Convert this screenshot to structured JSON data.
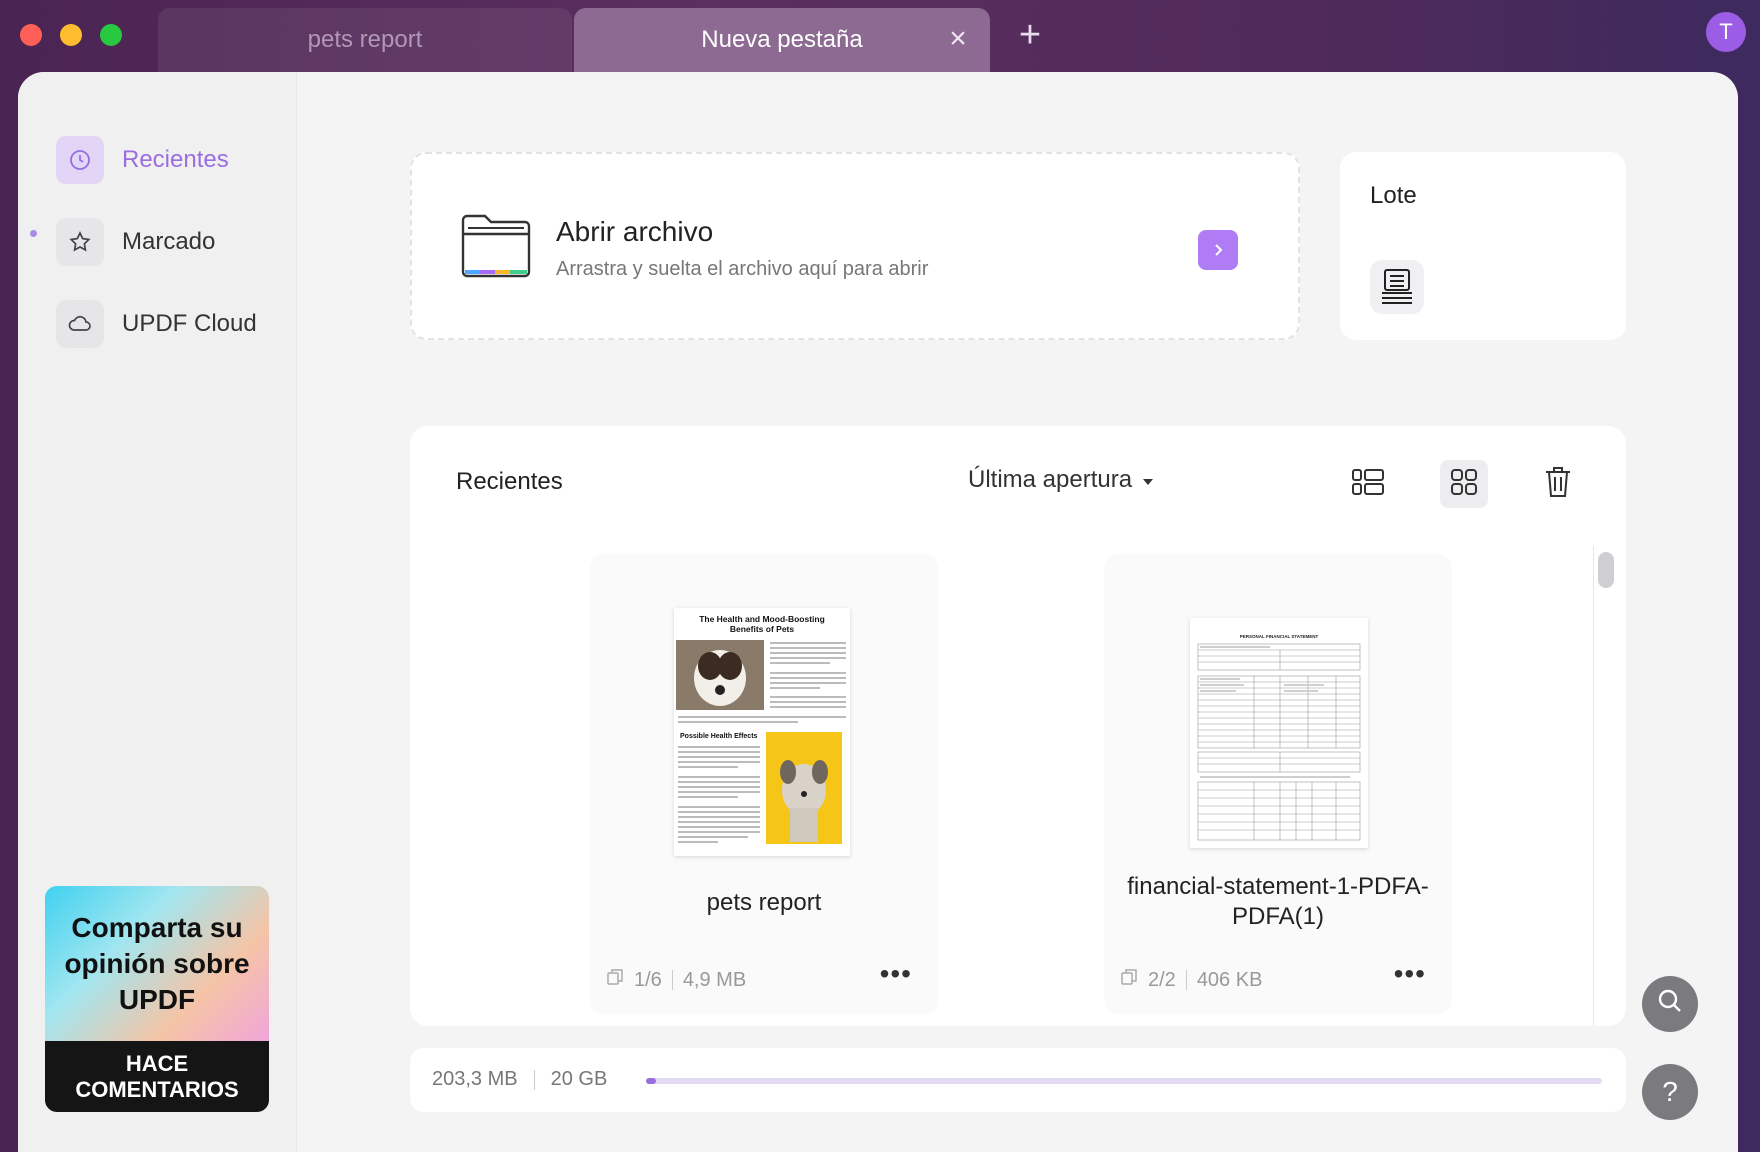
{
  "tabs": [
    {
      "label": "pets report",
      "active": false
    },
    {
      "label": "Nueva pestaña",
      "active": true
    }
  ],
  "avatar": {
    "initial": "T"
  },
  "sidebar": {
    "items": [
      {
        "label": "Recientes",
        "icon": "clock-icon",
        "active": true
      },
      {
        "label": "Marcado",
        "icon": "star-icon",
        "active": false
      },
      {
        "label": "UPDF Cloud",
        "icon": "cloud-icon",
        "active": false
      }
    ],
    "promo": {
      "title": "Comparta su opinión sobre UPDF",
      "cta": "HACE COMENTARIOS"
    }
  },
  "open_file": {
    "title": "Abrir archivo",
    "subtitle": "Arrastra y suelta el archivo aquí para abrir"
  },
  "batch": {
    "title": "Lote"
  },
  "recents": {
    "title": "Recientes",
    "sort_label": "Última apertura",
    "files": [
      {
        "name": "pets report",
        "pages": "1/6",
        "size": "4,9 MB",
        "thumb_title": "The Health and Mood-Boosting Benefits of Pets",
        "thumb_heading": "Possible Health Effects"
      },
      {
        "name": "financial-statement-1-PDFA-PDFA(1)",
        "pages": "2/2",
        "size": "406 KB",
        "thumb_title": "PERSONAL FINANCIAL STATEMENT"
      }
    ]
  },
  "storage": {
    "used": "203,3 MB",
    "total": "20 GB",
    "fraction": 0.01
  },
  "colors": {
    "accent": "#9a6ee0",
    "accent_button": "#b07cf5"
  }
}
